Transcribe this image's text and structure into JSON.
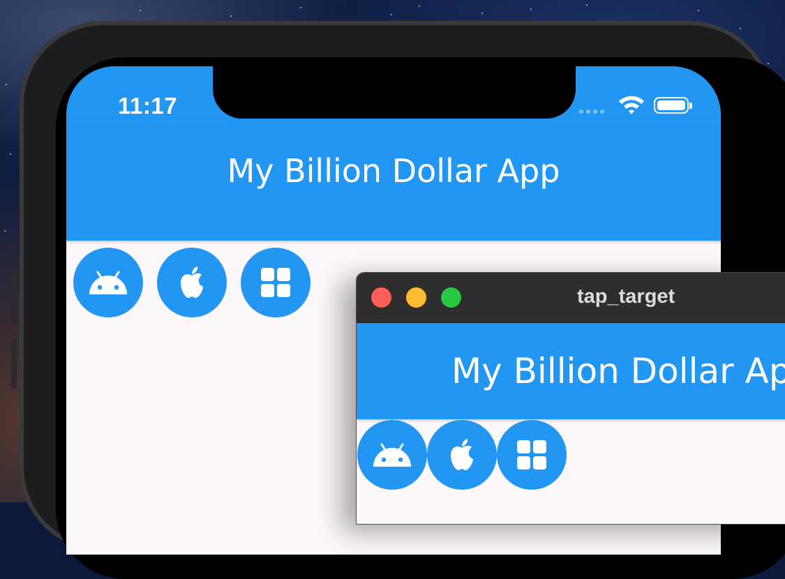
{
  "phone": {
    "status_time": "11:17",
    "app_bar_title": "My Billion Dollar App",
    "buttons": [
      {
        "icon": "android-icon"
      },
      {
        "icon": "apple-icon"
      },
      {
        "icon": "windows-icon"
      }
    ]
  },
  "desktop_window": {
    "title": "tap_target",
    "app_bar_title": "My Billion Dollar App",
    "buttons": [
      {
        "icon": "android-icon"
      },
      {
        "icon": "apple-icon"
      },
      {
        "icon": "windows-icon"
      }
    ]
  },
  "colors": {
    "primary": "#2196f3",
    "background": "#fcf8fc",
    "traffic_close": "#ff5f57",
    "traffic_minimize": "#febc2e",
    "traffic_zoom": "#28c840"
  }
}
